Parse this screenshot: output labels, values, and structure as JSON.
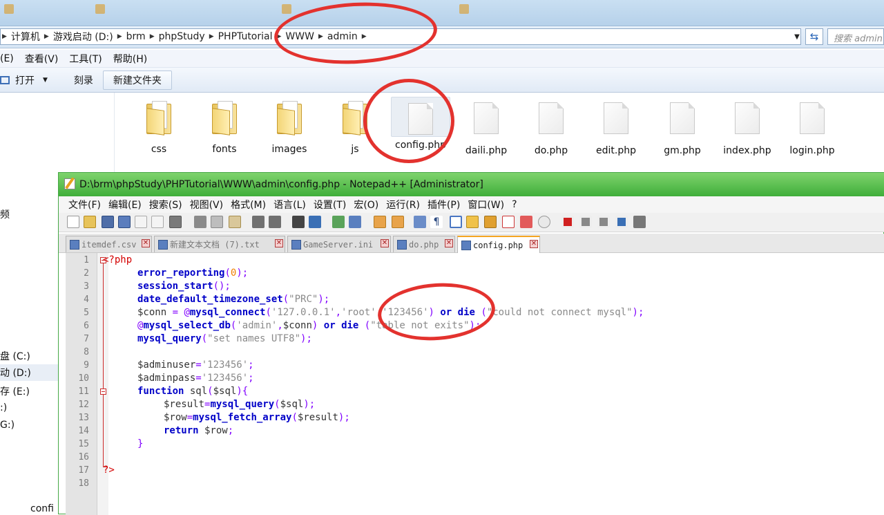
{
  "explorer": {
    "breadcrumb": [
      "计算机",
      "游戏启动 (D:)",
      "brm",
      "phpStudy",
      "PHPTutorial",
      "WWW",
      "admin"
    ],
    "search_placeholder": "搜索 admin",
    "menu": [
      "(E)",
      "查看(V)",
      "工具(T)",
      "帮助(H)"
    ],
    "commands": {
      "open": "打开",
      "burn": "刻录",
      "new_folder": "新建文件夹"
    },
    "nav_items": [
      "频",
      "盘 (C:)",
      "动 (D:)",
      "存 (E:)",
      ":)",
      "G:)"
    ],
    "files": [
      {
        "name": "css",
        "kind": "folder"
      },
      {
        "name": "fonts",
        "kind": "folder"
      },
      {
        "name": "images",
        "kind": "folder"
      },
      {
        "name": "js",
        "kind": "folder"
      },
      {
        "name": "config.php",
        "kind": "doc"
      },
      {
        "name": "daili.php",
        "kind": "doc"
      },
      {
        "name": "do.php",
        "kind": "doc"
      },
      {
        "name": "edit.php",
        "kind": "doc"
      },
      {
        "name": "gm.php",
        "kind": "doc"
      },
      {
        "name": "index.php",
        "kind": "doc"
      },
      {
        "name": "login.php",
        "kind": "doc"
      }
    ],
    "stray_label": "confi"
  },
  "npp": {
    "title": "D:\\brm\\phpStudy\\PHPTutorial\\WWW\\admin\\config.php - Notepad++ [Administrator]",
    "menu": [
      "文件(F)",
      "编辑(E)",
      "搜索(S)",
      "视图(V)",
      "格式(M)",
      "语言(L)",
      "设置(T)",
      "宏(O)",
      "运行(R)",
      "插件(P)",
      "窗口(W)",
      "?"
    ],
    "tabs": [
      "itemdef.csv",
      "新建文本文档 (7).txt",
      "GameServer.ini",
      "do.php",
      "config.php"
    ],
    "line_numbers": [
      "1",
      "2",
      "3",
      "4",
      "5",
      "6",
      "7",
      "8",
      "9",
      "10",
      "11",
      "12",
      "13",
      "14",
      "15",
      "16",
      "17",
      "18"
    ],
    "code": {
      "l1": "<?php",
      "l2a": "error_reporting",
      "l2b": "(",
      "l2c": "0",
      "l2d": ");",
      "l3a": "session_start",
      "l3b": "();",
      "l4a": "date_default_timezone_set",
      "l4b": "(",
      "l4c": "\"PRC\"",
      "l4d": ");",
      "l5a": "$conn",
      "l5b": " = @",
      "l5c": "mysql_connect",
      "l5d": "(",
      "l5e": "'127.0.0.1'",
      "l5f": ",",
      "l5g": "'root'",
      "l5h": ",",
      "l5i": "'123456'",
      "l5j": ") ",
      "l5k": "or",
      "l5l": " ",
      "l5m": "die",
      "l5n": " (",
      "l5o": "\"could not connect mysql\"",
      "l5p": ");",
      "l6a": "@",
      "l6b": "mysql_select_db",
      "l6c": "(",
      "l6d": "'admin'",
      "l6e": ",",
      "l6f": "$conn",
      "l6g": ") ",
      "l6h": "or",
      "l6i": " ",
      "l6j": "die",
      "l6k": " (",
      "l6l": "\"table not exits\"",
      "l6m": ");",
      "l7a": "mysql_query",
      "l7b": "(",
      "l7c": "\"set names UTF8\"",
      "l7d": ");",
      "l9a": "$adminuser",
      "l9b": "=",
      "l9c": "'123456'",
      "l9d": ";",
      "l10a": "$adminpass",
      "l10b": "=",
      "l10c": "'123456'",
      "l10d": ";",
      "l11a": "function",
      "l11b": " sql",
      "l11c": "(",
      "l11d": "$sql",
      "l11e": "){",
      "l12a": "$result",
      "l12b": "=",
      "l12c": "mysql_query",
      "l12d": "(",
      "l12e": "$sql",
      "l12f": ");",
      "l13a": "$row",
      "l13b": "=",
      "l13c": "mysql_fetch_array",
      "l13d": "(",
      "l13e": "$result",
      "l13f": ");",
      "l14a": "return",
      "l14b": " $row",
      "l14c": ";",
      "l15": "}",
      "l17": "?>"
    }
  }
}
